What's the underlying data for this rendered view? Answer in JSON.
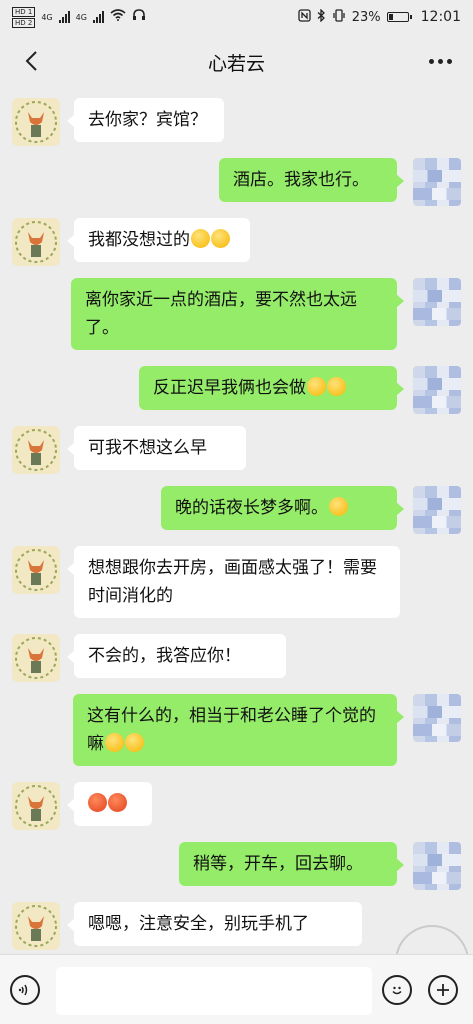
{
  "status_bar": {
    "sim1": "HD 1",
    "sim2": "HD 2",
    "net1": "4G",
    "net2": "4G",
    "battery_percent": "23%",
    "battery_level": 0.23,
    "time": "12:01",
    "icons": [
      "nfc-icon",
      "bluetooth-icon",
      "vibrate-icon",
      "wifi-icon",
      "headset-icon"
    ]
  },
  "header": {
    "title": "心若云",
    "back_icon": "chevron-left-icon",
    "more_icon": "more-dots-icon"
  },
  "messages": [
    {
      "side": "left",
      "text": "去你家？宾馆？",
      "emojis": []
    },
    {
      "side": "right",
      "text": "酒店。我家也行。",
      "emojis": []
    },
    {
      "side": "left",
      "text": "我都没想过的",
      "emojis": [
        "dizzy-face",
        "dizzy-face"
      ]
    },
    {
      "side": "right",
      "text": "离你家近一点的酒店，要不然也太远了。",
      "emojis": []
    },
    {
      "side": "right",
      "text": "反正迟早我俩也会做",
      "emojis": [
        "smirk-face",
        "heart-eyes-face"
      ]
    },
    {
      "side": "left",
      "text": "可我不想这么早",
      "emojis": []
    },
    {
      "side": "right",
      "text": "晚的话夜长梦多啊。",
      "emojis": [
        "smirk-face"
      ]
    },
    {
      "side": "left",
      "text": "想想跟你去开房，画面感太强了！需要时间消化的",
      "emojis": []
    },
    {
      "side": "left",
      "text": "不会的，我答应你！",
      "emojis": []
    },
    {
      "side": "right",
      "text": "这有什么的，相当于和老公睡了个觉的嘛",
      "emojis": [
        "laugh-cry-face",
        "laugh-cry-face"
      ]
    },
    {
      "side": "left",
      "text": "",
      "emojis": [
        "angry-face",
        "angry-face"
      ]
    },
    {
      "side": "right",
      "text": "稍等，开车，回去聊。",
      "emojis": []
    },
    {
      "side": "left",
      "text": "嗯嗯，注意安全，别玩手机了",
      "emojis": []
    }
  ],
  "input_bar": {
    "voice_icon": "voice-icon",
    "emoji_icon": "emoji-icon",
    "plus_icon": "plus-icon",
    "placeholder": ""
  },
  "colors": {
    "background": "#ededed",
    "self_bubble": "#95ec69",
    "other_bubble": "#ffffff"
  }
}
